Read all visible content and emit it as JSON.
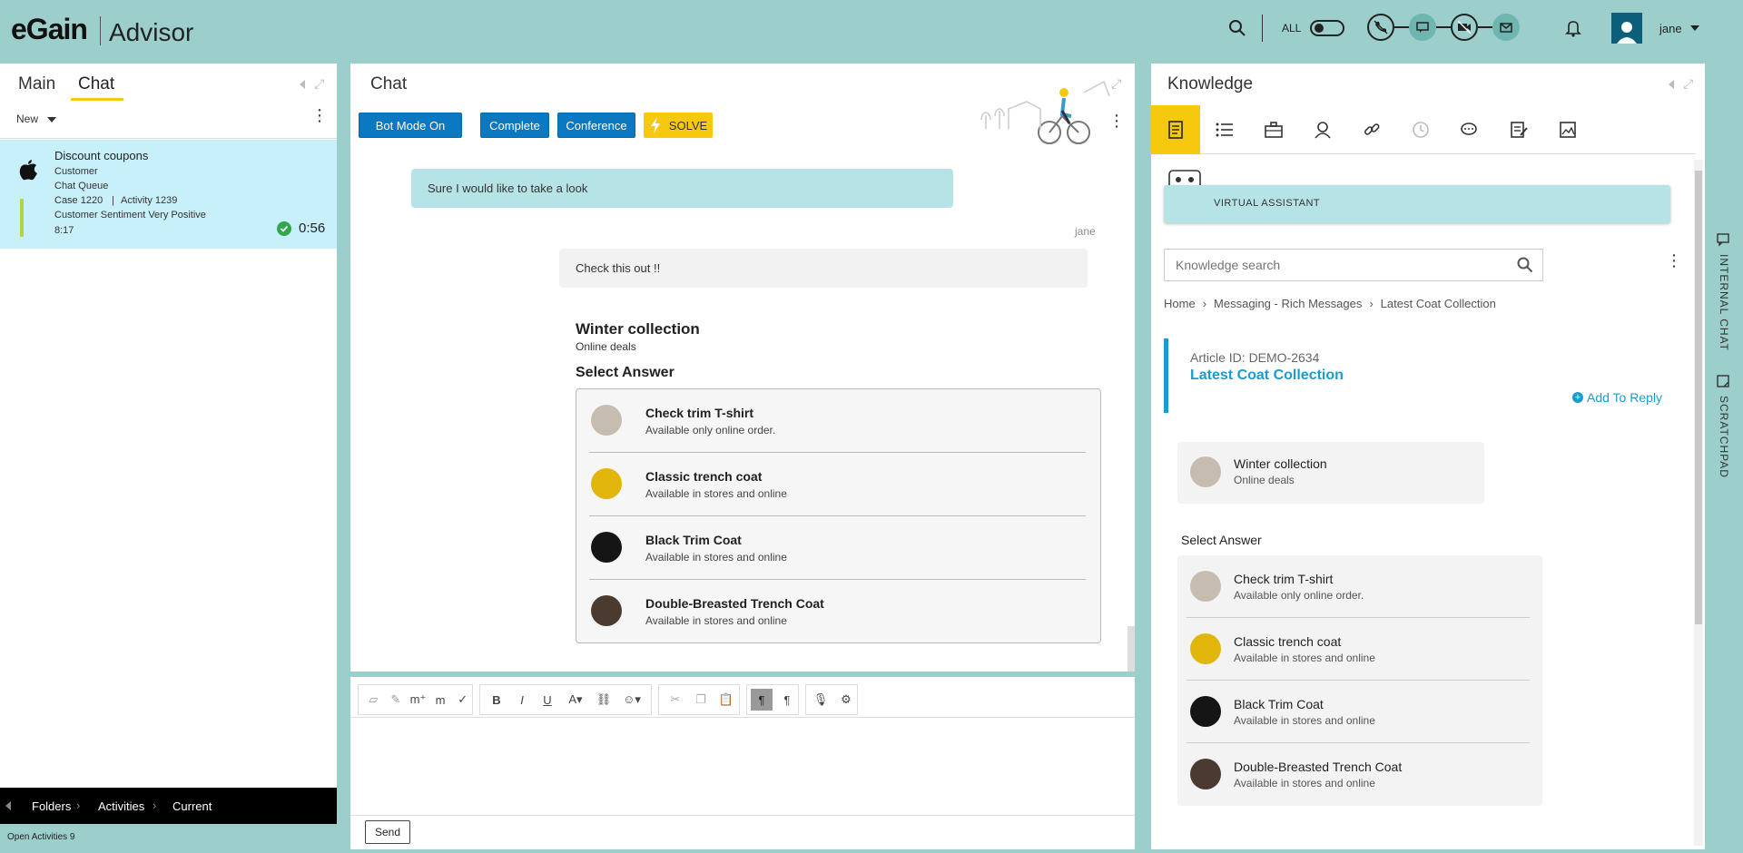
{
  "header": {
    "logo": "eGain",
    "product": "Advisor",
    "filter_label": "ALL",
    "user_name": "jane"
  },
  "left": {
    "tabs": [
      {
        "label": "Main"
      },
      {
        "label": "Chat"
      }
    ],
    "new_label": "New",
    "activity": {
      "title": "Discount coupons",
      "customer": "Customer",
      "queue": "Chat Queue",
      "case": "Case 1220",
      "activity": "Activity 1239",
      "sentiment": "Customer Sentiment Very Positive",
      "time": "8:17",
      "timer": "0:56"
    },
    "breadcrumb": [
      "Folders",
      "Activities",
      "Current"
    ],
    "status": "Open Activities 9"
  },
  "chat": {
    "title": "Chat",
    "buttons": {
      "bot": "Bot Mode On",
      "complete": "Complete",
      "conference": "Conference",
      "solve": "SOLVE"
    },
    "messages": {
      "customer": "Sure I would like to take a look",
      "agent_name": "jane",
      "agent": "Check this out !!"
    },
    "rich": {
      "title": "Winter collection",
      "subtitle": "Online deals",
      "select_label": "Select Answer",
      "items": [
        {
          "title": "Check trim T-shirt",
          "sub": "Available only online order."
        },
        {
          "title": "Classic trench coat",
          "sub": "Available in stores and online"
        },
        {
          "title": "Black Trim Coat",
          "sub": "Available in stores and online"
        },
        {
          "title": "Double-Breasted Trench Coat",
          "sub": "Available in stores and online"
        }
      ]
    },
    "send_label": "Send"
  },
  "knowledge": {
    "title": "Knowledge",
    "va_label": "VIRTUAL ASSISTANT",
    "search_placeholder": "Knowledge search",
    "breadcrumb": [
      "Home",
      "Messaging - Rich Messages",
      "Latest Coat Collection"
    ],
    "article_id": "Article ID: DEMO-2634",
    "article_title": "Latest Coat Collection",
    "add_reply": "Add To Reply",
    "card": {
      "title": "Winter collection",
      "sub": "Online deals"
    },
    "select_label": "Select Answer",
    "items": [
      {
        "title": "Check trim T-shirt",
        "sub": "Available only online order."
      },
      {
        "title": "Classic trench coat",
        "sub": "Available in stores and online"
      },
      {
        "title": "Black Trim Coat",
        "sub": "Available in stores and online"
      },
      {
        "title": "Double-Breasted Trench Coat",
        "sub": "Available in stores and online"
      }
    ]
  },
  "side": {
    "internal_chat": "INTERNAL CHAT",
    "scratchpad": "SCRATCHPAD"
  },
  "colors": {
    "accent_blue": "#0b78c2",
    "solve_yellow": "#f6c90e",
    "background_teal": "#9ccfcc",
    "selected_row": "#c8f0fa",
    "customer_bubble": "#b6e3e5"
  }
}
